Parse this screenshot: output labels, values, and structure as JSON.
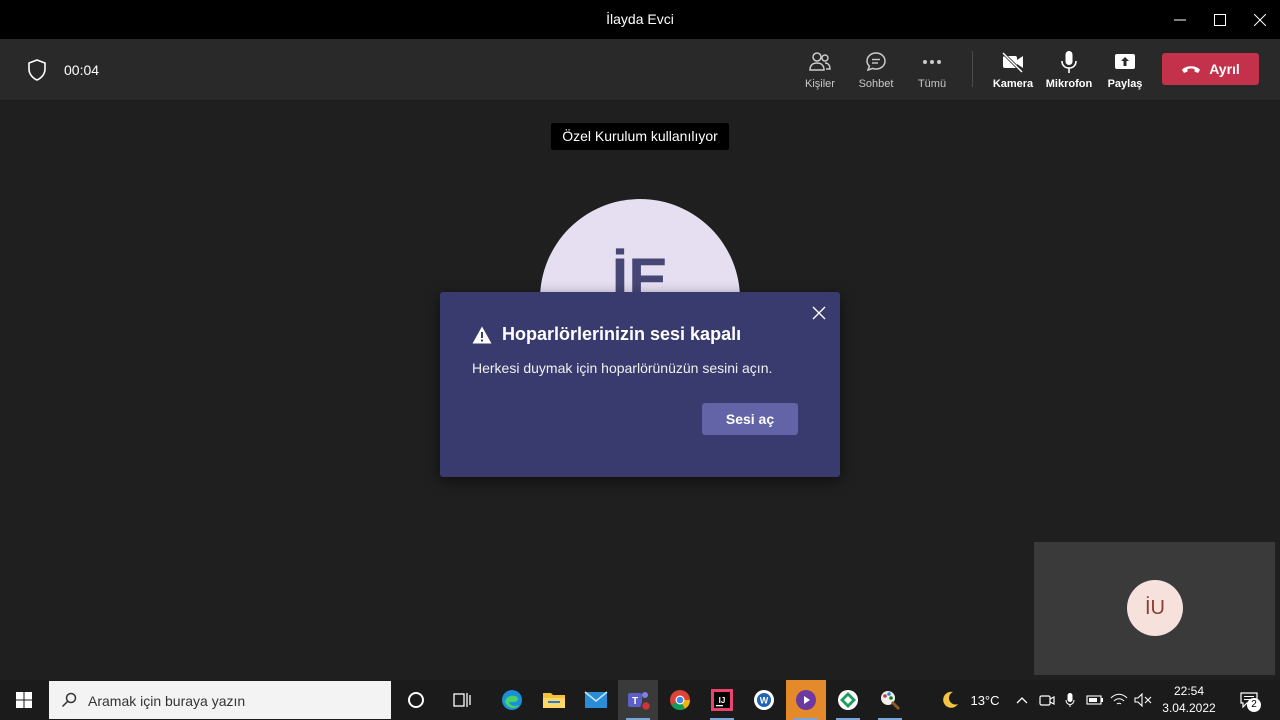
{
  "window": {
    "title": "İlayda Evci"
  },
  "meeting": {
    "elapsed": "00:04"
  },
  "toolbar": {
    "people_label": "Kişiler",
    "chat_label": "Sohbet",
    "more_label": "Tümü",
    "camera_label": "Kamera",
    "mic_label": "Mikrofon",
    "share_label": "Paylaş",
    "leave_label": "Ayrıl"
  },
  "stage": {
    "device_badge": "Özel Kurulum kullanılıyor",
    "participant_initials": "İE"
  },
  "dialog": {
    "title": "Hoparlörlerinizin sesi kapalı",
    "message": "Herkesi duymak için hoparlörünüzün sesini açın.",
    "action_label": "Sesi aç"
  },
  "self_view": {
    "initials": "İU"
  },
  "taskbar": {
    "search_placeholder": "Aramak için buraya yazın",
    "weather": "13°C",
    "time": "22:54",
    "date": "3.04.2022",
    "notification_count": "2"
  },
  "colors": {
    "leave_button": "#c4314b",
    "dialog_bg": "#393b6e",
    "primary_button": "#6264a7"
  }
}
